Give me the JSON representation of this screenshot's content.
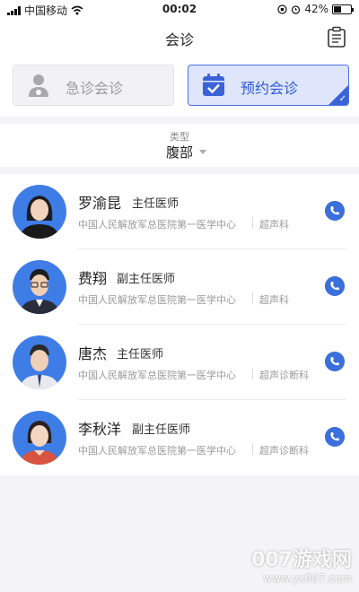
{
  "status_bar": {
    "carrier": "中国移动",
    "time": "00:02",
    "battery_percent": "42%"
  },
  "nav": {
    "title": "会诊",
    "action_icon": "clipboard-icon"
  },
  "modes": [
    {
      "label": "急诊会诊",
      "icon": "doctor-icon",
      "selected": false
    },
    {
      "label": "预约会诊",
      "icon": "calendar-check-icon",
      "selected": true
    }
  ],
  "filter": {
    "label": "类型",
    "value": "腹部"
  },
  "doctors": [
    {
      "name": "罗渝昆",
      "title": "主任医师",
      "hospital": "中国人民解放军总医院第一医学中心",
      "department": "超声科",
      "avatar": "female-avatar"
    },
    {
      "name": "费翔",
      "title": "副主任医师",
      "hospital": "中国人民解放军总医院第一医学中心",
      "department": "超声科",
      "avatar": "male-glasses-avatar"
    },
    {
      "name": "唐杰",
      "title": "主任医师",
      "hospital": "中国人民解放军总医院第一医学中心",
      "department": "超声诊断科",
      "avatar": "male-avatar"
    },
    {
      "name": "李秋洋",
      "title": "副主任医师",
      "hospital": "中国人民解放军总医院第一医学中心",
      "department": "超声诊断科",
      "avatar": "female-avatar"
    }
  ],
  "watermark": {
    "line1": "007游戏网",
    "line2": "www.yx007.com"
  },
  "colors": {
    "accent": "#3a63d8",
    "accent_light": "#dfe6fb",
    "avatar_bg": "#3f7de6",
    "call_button": "#3a6fdc"
  }
}
